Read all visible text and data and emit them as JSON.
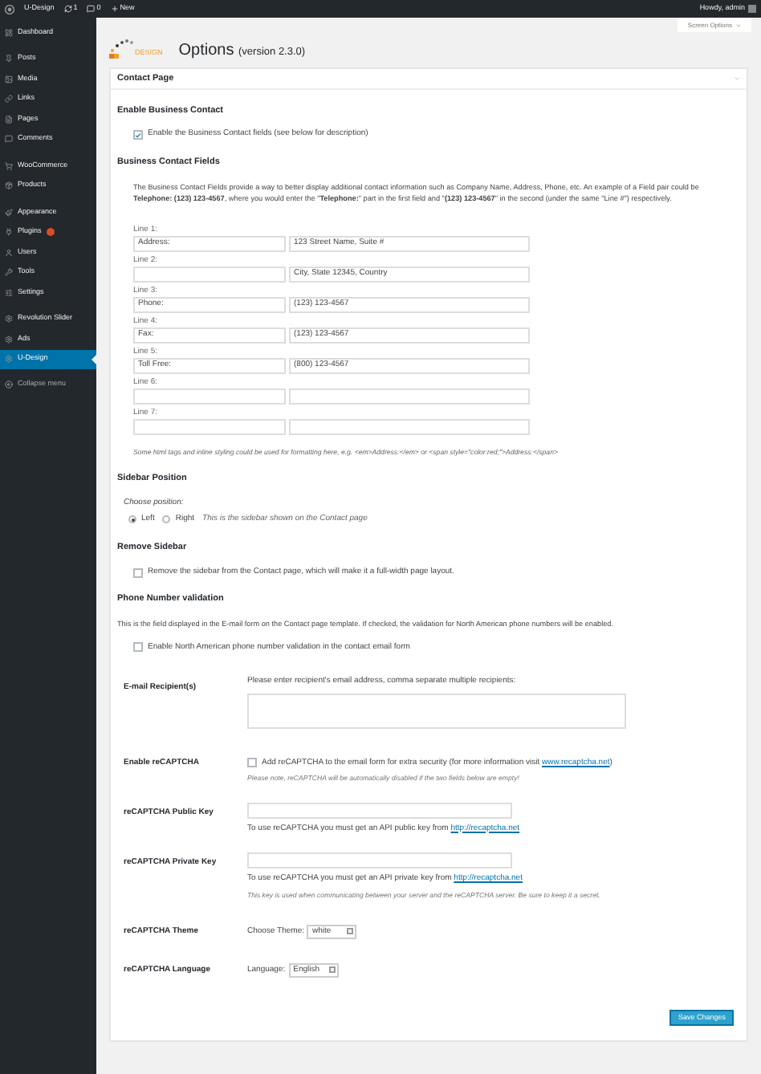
{
  "admin_bar": {
    "site": "U-Design",
    "updates": "1",
    "comments": "0",
    "new": "New",
    "greeting": "Howdy, admin"
  },
  "sidebar": {
    "groups": [
      [
        {
          "label": "Dashboard",
          "selected": false
        }
      ],
      [
        {
          "label": "Posts",
          "selected": false
        },
        {
          "label": "Media",
          "selected": false
        },
        {
          "label": "Links",
          "selected": false
        },
        {
          "label": "Pages",
          "selected": false
        },
        {
          "label": "Comments",
          "selected": false
        }
      ],
      [
        {
          "label": "WooCommerce",
          "selected": false
        },
        {
          "label": "Products",
          "selected": false
        }
      ],
      [
        {
          "label": "Appearance",
          "selected": false
        },
        {
          "label": "Plugins",
          "selected": false,
          "badge": true
        },
        {
          "label": "Users",
          "selected": false
        },
        {
          "label": "Tools",
          "selected": false
        },
        {
          "label": "Settings",
          "selected": false
        }
      ],
      [
        {
          "label": "Revolution Slider",
          "selected": false
        },
        {
          "label": "Ads",
          "selected": false
        },
        {
          "label": "U-Design",
          "selected": true
        }
      ]
    ],
    "collapse": "Collapse menu"
  },
  "screen_options": "Screen Options",
  "header": {
    "logo_text": "DESIGN",
    "title": "Options",
    "version": "(version 2.3.0)"
  },
  "panel": {
    "title": "Contact Page",
    "enable_business": {
      "heading": "Enable Business Contact",
      "label": "Enable the Business Contact fields (see below for description)",
      "checked": true
    },
    "fields": {
      "heading": "Business Contact Fields",
      "description": "The Business Contact Fields provide a way to better display additional contact information such as Company Name, Address, Phone, etc. An example of a Field pair could be **Telephone: (123) 123-4567**, where you would enter the \"**Telephone:**\" part in the first field and \"**(123) 123-4567**\" in the second (under the same \"Line #\") respectively.",
      "lines": [
        {
          "label": "Line 1:",
          "name": "Address:",
          "value": "123 Street Name, Suite #"
        },
        {
          "label": "Line 2:",
          "value": "City, State 12345, Country"
        },
        {
          "label": "Line 3:",
          "name": "Phone:",
          "value": "(123) 123-4567"
        },
        {
          "label": "Line 4:",
          "name": "Fax:",
          "value": "(123) 123-4567"
        },
        {
          "label": "Line 5:",
          "name": "Toll Free:",
          "value": "(800) 123-4567"
        },
        {
          "label": "Line 6:"
        },
        {
          "label": "Line 7:"
        }
      ],
      "note": "Some html tags and inline styling could be used for formatting here, e.g. <em>Address:</em> or <span style=\"color:red;\">Address:</span>"
    },
    "sidebar_position": {
      "heading": "Sidebar Position",
      "prompt": "Choose position:",
      "options": [
        {
          "label": "Left",
          "selected": true
        },
        {
          "label": "Right",
          "selected": false
        }
      ],
      "note": "This is the sidebar shown on the Contact page"
    },
    "remove_sidebar": {
      "heading": "Remove Sidebar",
      "label": "Remove the sidebar from the Contact page, which will make it a full-width page layout.",
      "checked": false
    },
    "phone_validation": {
      "heading": "Phone Number validation",
      "description": "This is the field displayed in the E-mail form on the Contact page template. If checked, the validation for North American phone numbers will be enabled.",
      "label": "Enable North American phone number validation in the contact email form",
      "checked": false
    },
    "email": {
      "label": "E-mail Recipient(s)",
      "hint": "Please enter recipient's email address, comma separate multiple recipients:"
    },
    "recaptcha": {
      "label": "Enable reCAPTCHA",
      "text": "Add reCAPTCHA to the email form for extra security (for more information visit ",
      "link": "www.recaptcha.net",
      "text_end": ")",
      "checked": false,
      "note": "Please note, reCAPTCHA will be automatically disabled if the two fields below are empty!"
    },
    "public_key": {
      "label": "reCAPTCHA Public Key",
      "help": "To use reCAPTCHA you must get an API public key from ",
      "link": "http://recaptcha.net"
    },
    "private_key": {
      "label": "reCAPTCHA Private Key",
      "help": "To use reCAPTCHA you must get an API private key from ",
      "link": "http://recaptcha.net",
      "note": "This key is used when communicating between your server and the reCAPTCHA server. Be sure to keep it a secret."
    },
    "theme": {
      "label": "reCAPTCHA Theme",
      "prompt": "Choose Theme:",
      "value": "white"
    },
    "language": {
      "label": "reCAPTCHA Language",
      "prompt": "Language:",
      "value": "English"
    },
    "save": "Save Changes"
  }
}
